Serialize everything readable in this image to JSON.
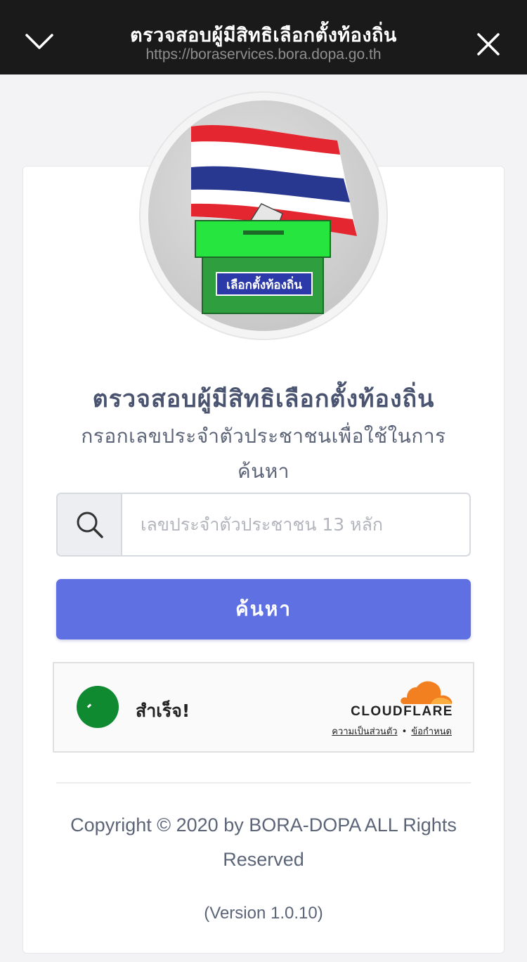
{
  "topbar": {
    "title": "ตรวจสอบผู้มีสิทธิเลือกตั้งท้องถิ่น",
    "url": "https://boraservices.bora.dopa.go.th",
    "collapse_icon": "chevron-down-icon",
    "close_icon": "close-icon"
  },
  "logo": {
    "ballot_label": "เลือกตั้งท้องถิ่น"
  },
  "main": {
    "title": "ตรวจสอบผู้มีสิทธิเลือกตั้งท้องถิ่น",
    "subtitle": "กรอกเลขประจำตัวประชาชนเพื่อใช้ในการค้นหา"
  },
  "search": {
    "icon": "search-icon",
    "placeholder": "เลขประจำตัวประชาชน 13 หลัก",
    "value": "",
    "button_label": "ค้นหา",
    "button_color": "#5f70e2"
  },
  "captcha": {
    "status": "สำเร็จ!",
    "status_color": "#108a30",
    "brand": "CLOUDFLARE",
    "brand_color": "#f38020",
    "privacy_link": "ความเป็นส่วนตัว",
    "separator": "•",
    "terms_link": "ข้อกำหนด"
  },
  "footer": {
    "copyright": "Copyright © 2020 by BORA-DOPA ALL Rights Reserved",
    "version": "(Version 1.0.10)"
  }
}
